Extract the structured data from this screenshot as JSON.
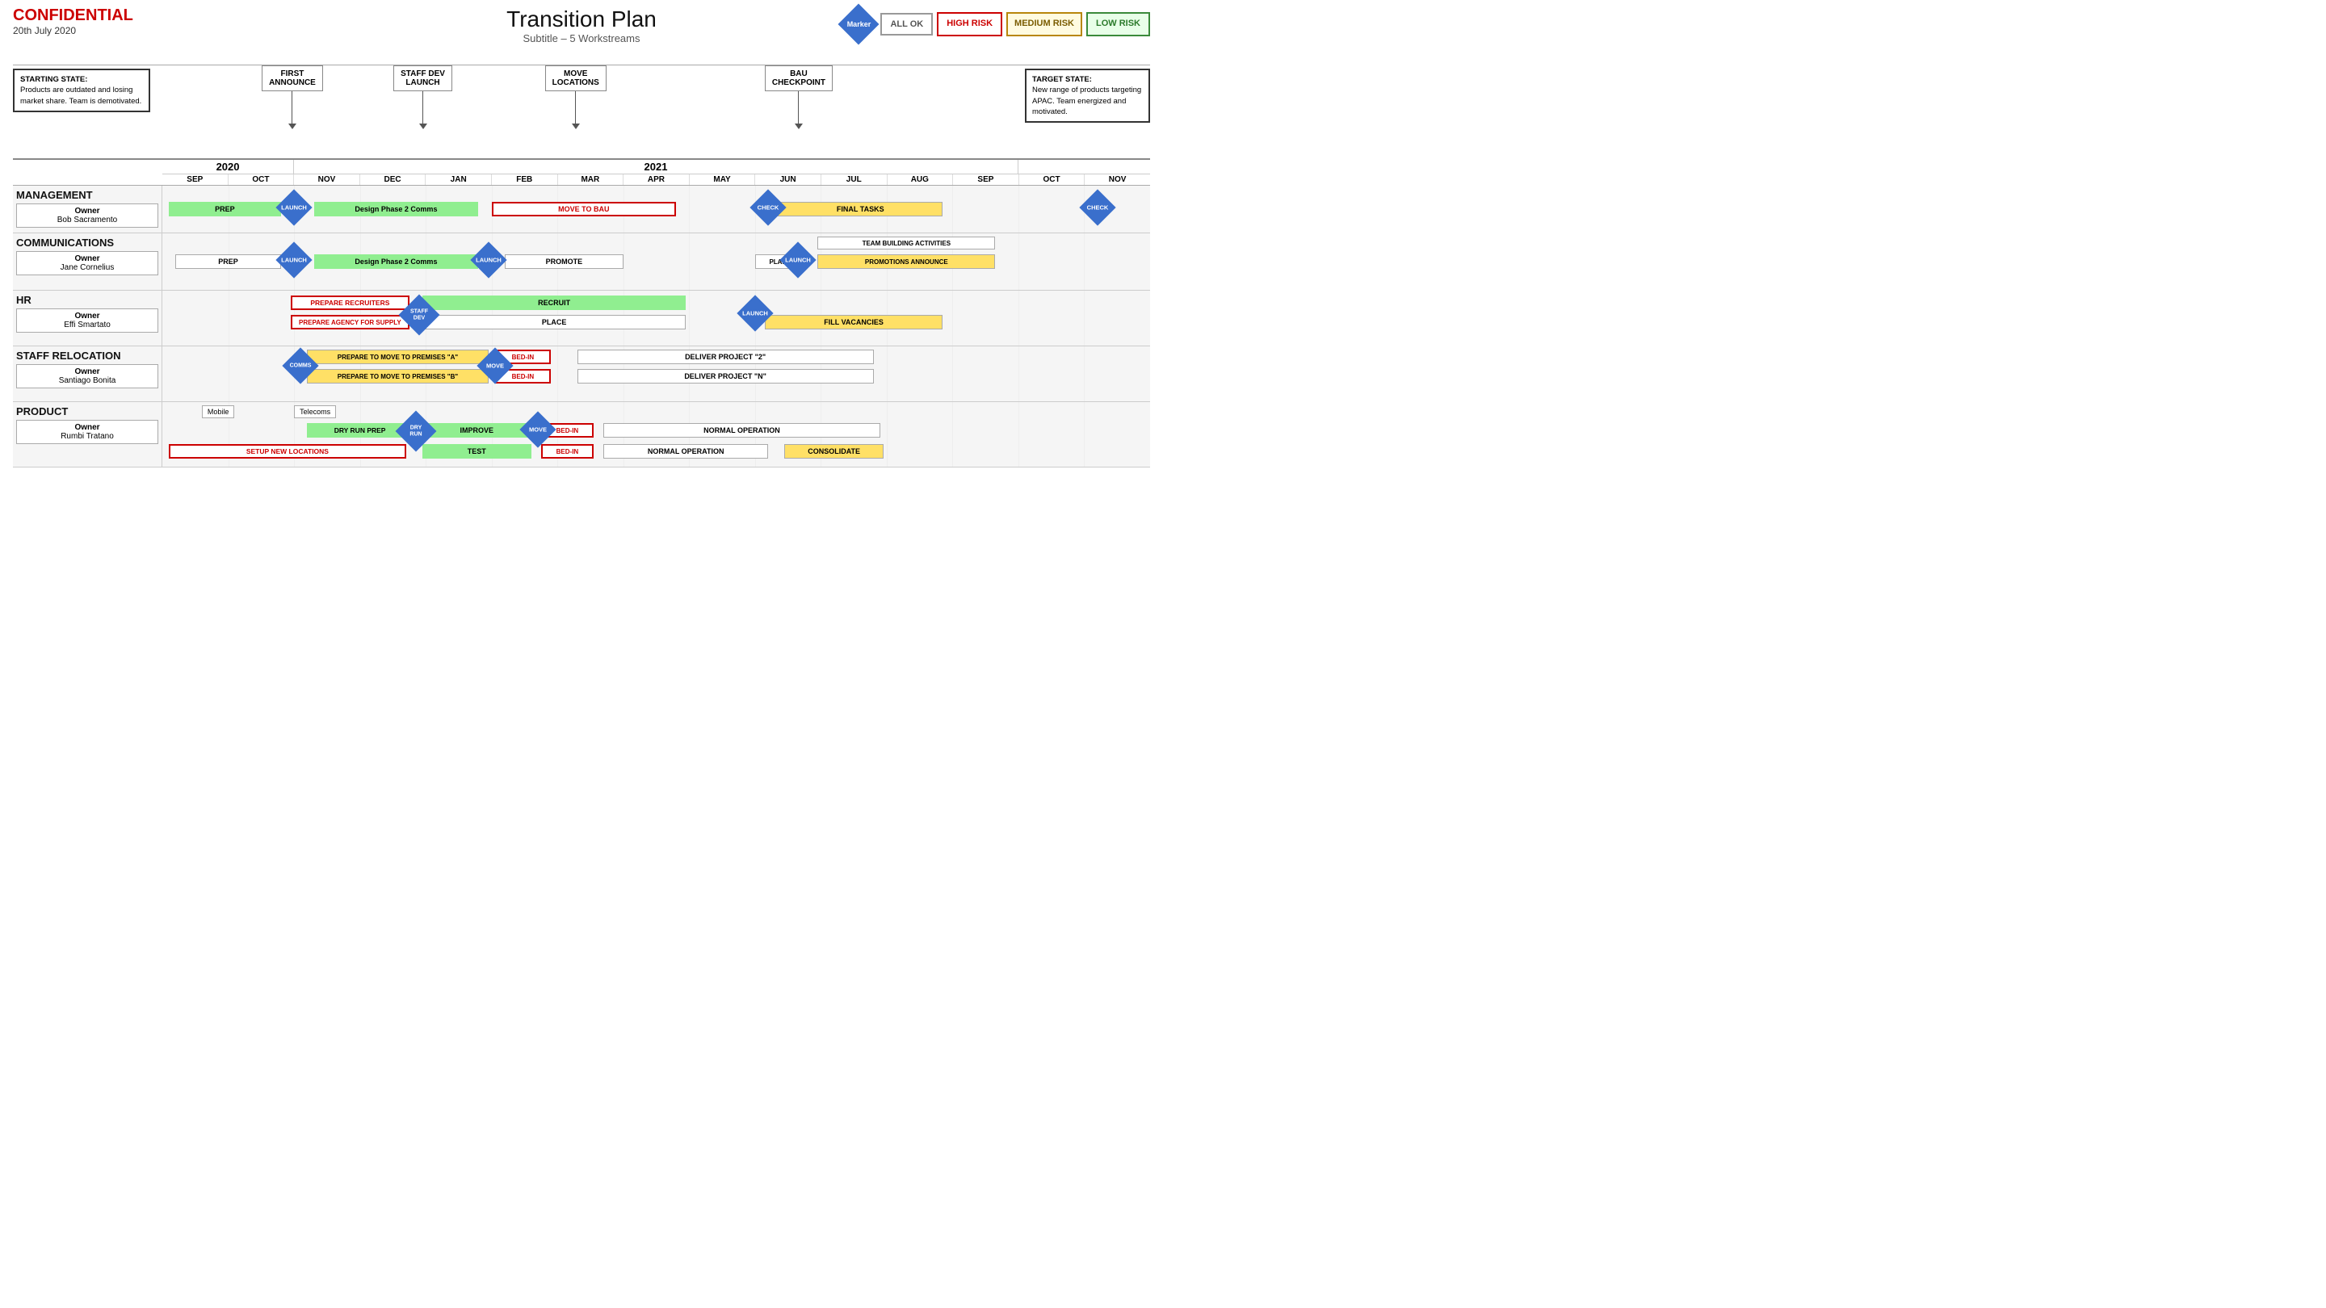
{
  "header": {
    "confidential": "CONFIDENTIAL",
    "date": "20th July 2020",
    "title": "Transition Plan",
    "subtitle": "Subtitle – 5 Workstreams",
    "marker_label": "Marker",
    "legend": {
      "all_ok": "ALL OK",
      "high_risk": "HIGH RISK",
      "medium_risk": "MEDIUM RISK",
      "low_risk": "LOW RISK"
    }
  },
  "starting_state": {
    "label": "STARTING STATE:",
    "text": "Products are outdated and losing market share. Team is demotivated."
  },
  "target_state": {
    "label": "TARGET STATE:",
    "text": "New range of products targeting APAC. Team energized and motivated."
  },
  "milestones": [
    {
      "label": "FIRST\nANNOUNCE",
      "col": 2
    },
    {
      "label": "STAFF DEV\nLAUNCH",
      "col": 4
    },
    {
      "label": "MOVE\nLOCATIONS",
      "col": 6
    },
    {
      "label": "BAU\nCHECKPOINT",
      "col": 9
    }
  ],
  "years": [
    {
      "label": "2020",
      "cols": 2
    },
    {
      "label": "2021",
      "cols": 11
    }
  ],
  "months": [
    "SEP",
    "OCT",
    "NOV",
    "DEC",
    "JAN",
    "FEB",
    "MAR",
    "APR",
    "MAY",
    "JUN",
    "JUL",
    "AUG",
    "SEP",
    "OCT",
    "NOV"
  ],
  "workstreams": [
    {
      "id": "management",
      "label": "MANAGEMENT",
      "owner_title": "Owner",
      "owner_name": "Bob Sacramento"
    },
    {
      "id": "communications",
      "label": "COMMUNICATIONS",
      "owner_title": "Owner",
      "owner_name": "Jane Cornelius"
    },
    {
      "id": "hr",
      "label": "HR",
      "owner_title": "Owner",
      "owner_name": "Effi Smartato"
    },
    {
      "id": "staff_relocation",
      "label": "STAFF RELOCATION",
      "owner_title": "Owner",
      "owner_name": "Santiago Bonita"
    },
    {
      "id": "product",
      "label": "PRODUCT",
      "owner_title": "Owner",
      "owner_name": "Rumbi Tratano"
    }
  ],
  "bars": {
    "management": [
      {
        "label": "PREP",
        "type": "green",
        "start": 0.1,
        "width": 1.6
      },
      {
        "label": "Design Phase 2 Comms",
        "type": "green",
        "start": 2.2,
        "width": 2.6
      },
      {
        "label": "MOVE TO BAU",
        "type": "red_outline",
        "start": 5.0,
        "width": 2.8
      },
      {
        "label": "FINAL TASKS",
        "type": "yellow",
        "start": 9.2,
        "width": 2.3
      }
    ],
    "management_diamonds": [
      {
        "label": "LAUNCH",
        "col": 2.05
      },
      {
        "label": "CHECK",
        "col": 9.0
      },
      {
        "label": "CHECK",
        "col": 13.9
      }
    ],
    "communications_row1": [
      {
        "label": "PREP",
        "type": "white",
        "start": 0.1,
        "width": 1.6
      },
      {
        "label": "Design Phase 2 Comms",
        "type": "green",
        "start": 2.2,
        "width": 2.5
      },
      {
        "label": "PROMOTE",
        "type": "white",
        "start": 5.2,
        "width": 1.8
      },
      {
        "label": "PLAN",
        "type": "white",
        "start": 8.85,
        "width": 0.7
      },
      {
        "label": "TEAM BUILDING ACTIVITIES",
        "type": "white",
        "start": 9.8,
        "width": 2.8
      },
      {
        "label": "PROMOTIONS ANNOUNCE",
        "type": "yellow",
        "start": 9.8,
        "width": 2.8
      }
    ],
    "communications_diamonds": [
      {
        "label": "LAUNCH",
        "col": 2.05
      },
      {
        "label": "LAUNCH",
        "col": 4.95
      },
      {
        "label": "LAUNCH",
        "col": 9.65
      }
    ],
    "hr_row1": [
      {
        "label": "PREPARE RECRUITERS",
        "type": "red_outline",
        "start": 1.85,
        "width": 1.9
      },
      {
        "label": "RECRUIT",
        "type": "green",
        "start": 3.85,
        "width": 4.0
      }
    ],
    "hr_row2": [
      {
        "label": "PREPARE AGENCY FOR SUPPLY",
        "type": "red_outline",
        "start": 1.85,
        "width": 1.9
      },
      {
        "label": "PLACE",
        "type": "white",
        "start": 3.85,
        "width": 4.0
      }
    ],
    "hr_diamonds": [
      {
        "label": "STAFF\nDEV",
        "col": 3.8
      },
      {
        "label": "LAUNCH",
        "col": 8.85
      }
    ],
    "hr_post1": [
      {
        "label": "FILL VACANCIES",
        "type": "yellow",
        "start": 9.05,
        "width": 2.8
      }
    ],
    "staffrel_row1": [
      {
        "label": "PREPARE TO MOVE TO PREMISES \"A\"",
        "type": "yellow",
        "start": 2.1,
        "width": 2.8
      },
      {
        "label": "BED-IN",
        "type": "red_outline",
        "start": 5.05,
        "width": 0.85
      },
      {
        "label": "DELIVER PROJECT \"2\"",
        "type": "white",
        "start": 6.4,
        "width": 4.5
      }
    ],
    "staffrel_row2": [
      {
        "label": "PREPARE TO MOVE TO PREMISES \"B\"",
        "type": "yellow",
        "start": 2.1,
        "width": 2.8
      },
      {
        "label": "BED-IN",
        "type": "red_outline",
        "start": 5.05,
        "width": 0.85
      },
      {
        "label": "DELIVER PROJECT \"N\"",
        "type": "white",
        "start": 6.4,
        "width": 4.5
      }
    ],
    "staffrel_diamonds": [
      {
        "label": "COMMS",
        "col": 2.05
      },
      {
        "label": "MOVE",
        "col": 5.0
      }
    ],
    "product_row1": [
      {
        "label": "DRY RUN PREP",
        "type": "green",
        "start": 2.2,
        "width": 1.7
      },
      {
        "label": "IMPROVE",
        "type": "green",
        "start": 4.0,
        "width": 1.7
      },
      {
        "label": "BED-IN",
        "type": "red_outline",
        "start": 5.75,
        "width": 0.85
      },
      {
        "label": "NORMAL OPERATION",
        "type": "white",
        "start": 6.6,
        "width": 4.3
      }
    ],
    "product_row2": [
      {
        "label": "SETUP NEW LOCATIONS",
        "type": "red_outline",
        "start": 0.1,
        "width": 3.6
      },
      {
        "label": "TEST",
        "type": "green",
        "start": 4.0,
        "width": 1.7
      },
      {
        "label": "BED-IN",
        "type": "red_outline",
        "start": 5.75,
        "width": 0.85
      },
      {
        "label": "NORMAL OPERATION",
        "type": "white",
        "start": 6.6,
        "width": 2.5
      },
      {
        "label": "CONSOLIDATE",
        "type": "yellow",
        "start": 9.4,
        "width": 1.5
      }
    ],
    "product_diamonds": [
      {
        "label": "DRY\nRUN",
        "col": 3.85
      },
      {
        "label": "MOVE",
        "col": 5.7
      }
    ]
  },
  "callouts": [
    {
      "label": "Mobile",
      "col": 0.9
    },
    {
      "label": "Telecoms",
      "col": 2.05
    }
  ]
}
